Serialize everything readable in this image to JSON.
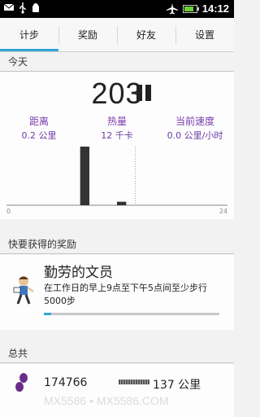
{
  "status_bar": {
    "time": "14:12",
    "left_icons": [
      "message-icon",
      "usb-icon",
      "android-debug-icon"
    ],
    "right_icons": [
      "airplane-icon",
      "battery-charging-icon"
    ]
  },
  "tabs": [
    {
      "label": "计步",
      "active": true
    },
    {
      "label": "奖励",
      "active": false
    },
    {
      "label": "好友",
      "active": false
    },
    {
      "label": "设置",
      "active": false
    }
  ],
  "today": {
    "header": "今天",
    "steps": "203",
    "metrics": [
      {
        "label": "距离",
        "value": "0.2 公里"
      },
      {
        "label": "热量",
        "value": "12 千卡"
      },
      {
        "label": "当前速度",
        "value": "0.0 公里/小时"
      }
    ]
  },
  "chart_data": {
    "type": "bar",
    "x_range": [
      0,
      24
    ],
    "tick_labels": [
      "0",
      "24"
    ],
    "bars": [
      {
        "hour": 8,
        "value": 100
      },
      {
        "hour": 12,
        "value": 6
      }
    ],
    "current_hour": 14,
    "colors": {
      "bar": "#333333",
      "axis": "#888888"
    }
  },
  "awards": {
    "header": "快要获得的奖励",
    "title": "勤劳的文员",
    "description": "在工作日的早上9点至下午5点间至少步行5000步",
    "progress": 0.04,
    "icon": "clerk-walking-icon"
  },
  "total": {
    "header": "总共",
    "steps": "174766",
    "distance": "137 公里",
    "icon": "footprints-icon"
  },
  "watermark": "MX5586 • MX5586.COM",
  "colors": {
    "accent": "#31a4d8",
    "metric": "#7a3bb0"
  }
}
